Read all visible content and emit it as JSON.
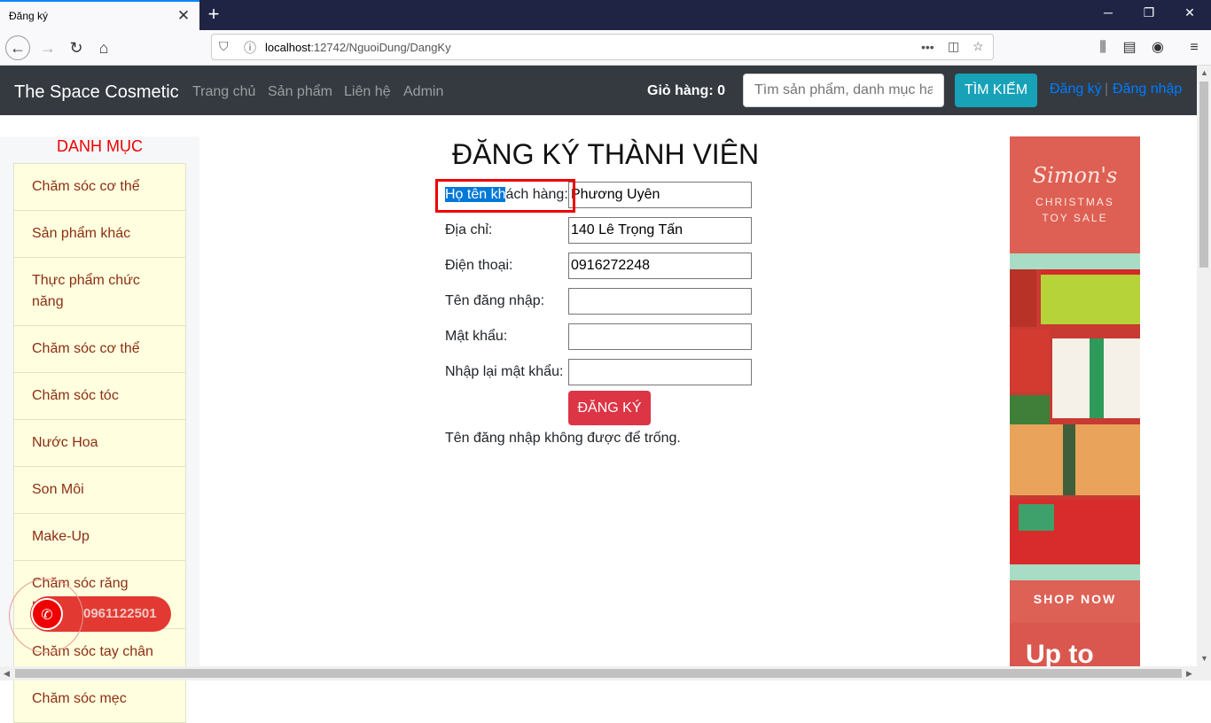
{
  "browser": {
    "tab_title": "Đăng ký",
    "tab_close": "✕",
    "new_tab": "+",
    "url_host": "localhost",
    "url_rest": ":12742/NguoiDung/DangKy",
    "more": "•••"
  },
  "site": {
    "brand": "The Space Cosmetic",
    "nav": [
      "Trang chủ",
      "Sản phẩm",
      "Liên hệ",
      "Admin"
    ],
    "cart": "Giỏ hàng: 0",
    "search_placeholder": "Tìm sản phẩm, danh mục hay",
    "search_button": "TÌM KIẾM",
    "register_link": "Đăng ký",
    "separator": "|",
    "login_link": "Đăng nhập"
  },
  "sidebar": {
    "title": "DANH MỤC",
    "items": [
      "Chăm sóc cơ thể",
      "Sản phẩm khác",
      "Thực phẩm chức năng",
      "Chăm sóc cơ thể",
      "Chăm sóc tóc",
      "Nước Hoa",
      "Son Môi",
      "Make-Up",
      "Chăm sóc răng miệng",
      "Chăm sóc tay chân",
      "Chăm sóc mẹc"
    ]
  },
  "form": {
    "title": "ĐĂNG KÝ THÀNH VIÊN",
    "fullname_label_selected": "Họ tên kh",
    "fullname_label_rest": "ách hàng:",
    "fullname_value": "Phương Uyên",
    "address_label": "Địa chỉ:",
    "address_value": "140 Lê Trọng Tấn",
    "phone_label": "Điện thoại:",
    "phone_value": "0916272248",
    "username_label": "Tên đăng nhập:",
    "username_value": "",
    "password_label": "Mật khẩu:",
    "password_value": "",
    "confirm_label": "Nhập lại mật khẩu:",
    "confirm_value": "",
    "submit": "ĐĂNG KÝ",
    "error": "Tên đăng nhập không được để trống."
  },
  "ad": {
    "brand": "Simon's",
    "line1": "CHRISTMAS",
    "line2": "TOY SALE",
    "shop": "SHOP NOW",
    "upto": "Up to"
  },
  "phone_widget": {
    "number": "0961122501"
  }
}
